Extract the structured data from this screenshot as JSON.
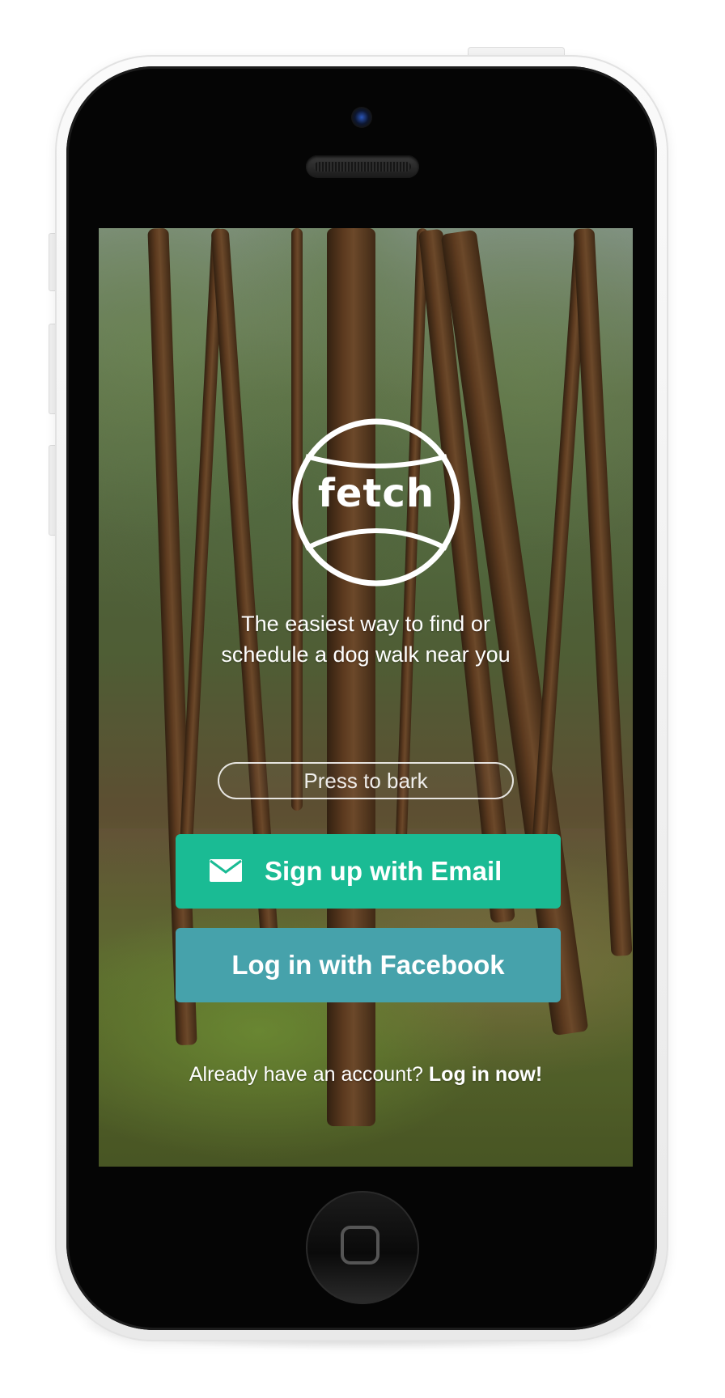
{
  "app": {
    "logo_text": "fetch",
    "tagline_line1": "The easiest way to find or",
    "tagline_line2": "schedule a dog walk near you"
  },
  "actions": {
    "bark_label": "Press to bark",
    "email_signup_label": "Sign up with Email",
    "facebook_login_label": "Log in with Facebook"
  },
  "footer": {
    "prompt": "Already have an account?",
    "login_link": "Log in now!"
  },
  "icons": {
    "email": "envelope-icon",
    "home": "home-button-square"
  },
  "colors": {
    "email_button": "#1abb94",
    "facebook_button": "#46a2ab",
    "phone_body": "#f4f4f4",
    "phone_face": "#050505"
  }
}
